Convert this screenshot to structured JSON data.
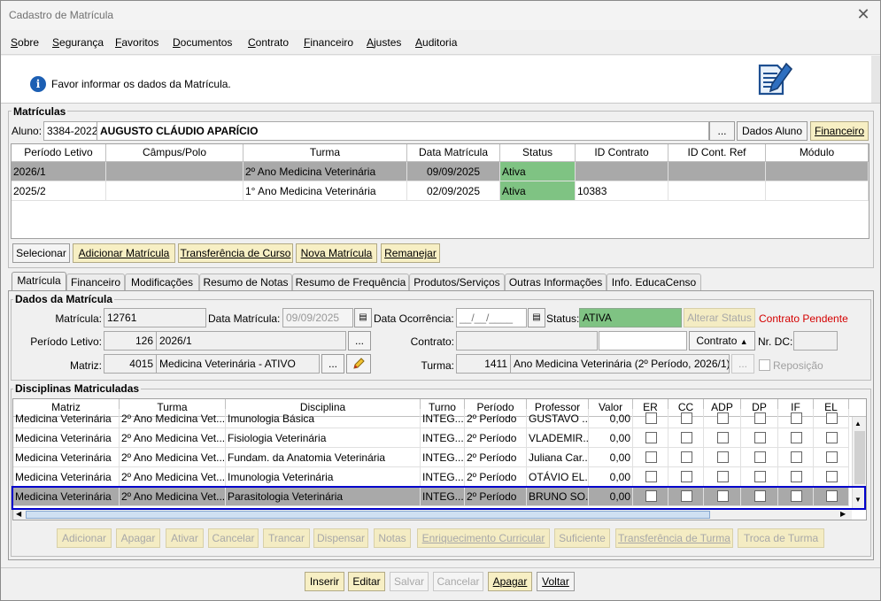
{
  "window": {
    "title": "Cadastro de Matrícula"
  },
  "menu": [
    "Sobre",
    "Segurança",
    "Favoritos",
    "Documentos",
    "Contrato",
    "Financeiro",
    "Ajustes",
    "Auditoria"
  ],
  "info": {
    "message": "Favor informar os dados da Matrícula."
  },
  "matriculas": {
    "title": "Matrículas",
    "aluno_label": "Aluno:",
    "aluno_codigo": "3384-2022",
    "aluno_nome": "AUGUSTO CLÁUDIO APARÍCIO",
    "lookup_label": "...",
    "dados_aluno_label": "Dados Aluno",
    "financeiro_label": "Financeiro",
    "columns": [
      "Período Letivo",
      "Câmpus/Polo",
      "Turma",
      "Data Matrícula",
      "Status",
      "ID Contrato",
      "ID Cont. Ref",
      "Módulo"
    ],
    "rows": [
      {
        "periodo": "2026/1",
        "campus": "",
        "turma": "2º Ano Medicina Veterinária",
        "data": "09/09/2025",
        "status": "Ativa",
        "contrato": "",
        "ref": "",
        "modulo": ""
      },
      {
        "periodo": "2025/2",
        "campus": "",
        "turma": "1°  Ano Medicina Veterinária",
        "data": "02/09/2025",
        "status": "Ativa",
        "contrato": "10383",
        "ref": "",
        "modulo": ""
      }
    ],
    "buttons": [
      "Selecionar",
      "Adicionar Matrícula",
      "Transferência de Curso",
      "Nova Matrícula",
      "Remanejar"
    ]
  },
  "tabs": [
    "Matrícula",
    "Financeiro",
    "Modificações",
    "Resumo de Notas",
    "Resumo de Frequência",
    "Produtos/Serviços",
    "Outras Informações",
    "Info. EducaCenso"
  ],
  "dados": {
    "title": "Dados da Matrícula",
    "matricula_label": "Matrícula:",
    "matricula": "12761",
    "data_matricula_label": "Data Matrícula:",
    "data_matricula": "09/09/2025",
    "data_ocorrencia_label": "Data Ocorrência:",
    "data_ocorrencia": "__/__/____",
    "status_label": "Status:",
    "status": "ATIVA",
    "alterar_status_label": "Alterar Status",
    "contrato_pendente": "Contrato Pendente",
    "periodo_label": "Período Letivo:",
    "periodo_codigo": "126",
    "periodo": "2026/1",
    "contrato_label": "Contrato:",
    "contrato_btn_label": "Contrato",
    "nr_dc_label": "Nr. DC:",
    "matriz_label": "Matriz:",
    "matriz_codigo": "4015",
    "matriz": "Medicina Veterinária - ATIVO",
    "turma_label": "Turma:",
    "turma_codigo": "1411",
    "turma": "Ano Medicina Veterinária (2º Período, 2026/1)",
    "reposicao_label": "Reposição"
  },
  "disciplinas": {
    "title": "Disciplinas Matriculadas",
    "columns": [
      "Matriz",
      "Turma",
      "Disciplina",
      "Turno",
      "Período",
      "Professor",
      "Valor",
      "ER",
      "CC",
      "ADP",
      "DP",
      "IF",
      "EL"
    ],
    "rows": [
      {
        "matriz": "Medicina Veterinária",
        "turma": "2º Ano Medicina Vet...",
        "disciplina": "Imunologia Básica",
        "turno": "INTEG...",
        "periodo": "2º Período",
        "professor": "GUSTAVO ...",
        "valor": "0,00"
      },
      {
        "matriz": "Medicina Veterinária",
        "turma": "2º Ano Medicina Vet...",
        "disciplina": "Fisiologia Veterinária",
        "turno": "INTEG...",
        "periodo": "2º Período",
        "professor": "VLADEMIR...",
        "valor": "0,00"
      },
      {
        "matriz": "Medicina Veterinária",
        "turma": "2º Ano Medicina Vet...",
        "disciplina": "Fundam. da Anatomia Veterinária",
        "turno": "INTEG...",
        "periodo": "2º Período",
        "professor": "Juliana Car...",
        "valor": "0,00"
      },
      {
        "matriz": "Medicina Veterinária",
        "turma": "2º Ano Medicina Vet...",
        "disciplina": "Imunologia Veterinária",
        "turno": "INTEG...",
        "periodo": "2º Período",
        "professor": "OTÁVIO EL...",
        "valor": "0,00"
      },
      {
        "matriz": "Medicina Veterinária",
        "turma": "2º Ano Medicina Vet...",
        "disciplina": "Parasitologia Veterinária",
        "turno": "INTEG...",
        "periodo": "2º Período",
        "professor": "BRUNO SO...",
        "valor": "0,00"
      }
    ],
    "buttons": [
      "Adicionar",
      "Apagar",
      "Ativar",
      "Cancelar",
      "Trancar",
      "Dispensar",
      "Notas",
      "Enriquecimento Curricular",
      "Suficiente",
      "Transferência de Turma",
      "Troca de Turma"
    ]
  },
  "footer": {
    "buttons": [
      "Inserir",
      "Editar",
      "Salvar",
      "Cancelar",
      "Apagar",
      "Voltar"
    ]
  },
  "colors": {
    "status_green": "#7fc383",
    "selected_row": "#a9a9a9",
    "button_yellow": "#f7efc4",
    "focus_blue": "#0000cc",
    "warning_red": "#d40000"
  }
}
